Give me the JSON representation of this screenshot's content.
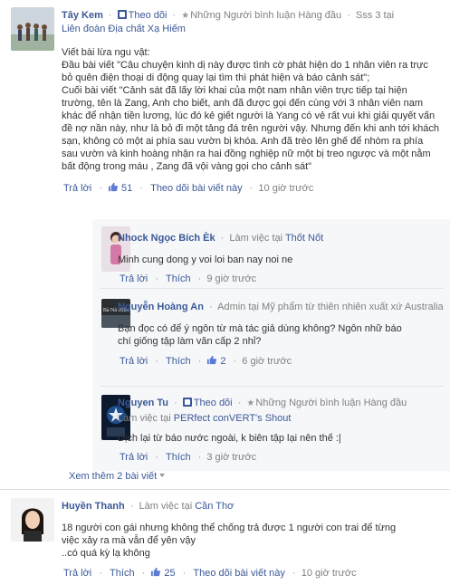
{
  "comments": [
    {
      "author": "Tây Kem",
      "follow_label": "Theo dõi",
      "badge": "Những Người bình luận Hàng đầu",
      "extra": "Sss 3 tại",
      "workplace": "Liên đoàn Địa chất Xạ Hiếm",
      "text": "Viết bài lừa ngu vật:\nĐầu bài viết \"Câu chuyện kinh dị này được tình cờ phát hiện do 1 nhân viên ra trực bỏ quên điện thoại di động quay lại tìm thì phát hiện và báo cảnh sát\";\nCuối bài viết \"Cảnh sát đã lấy lời khai của một nam nhân viên trực tiếp tại hiện trường, tên là Zang, Anh cho biết, anh đã được gọi đến cùng với 3 nhân viên nam khác để nhận tiền lương, lúc đó kẻ giết người là Yang có vẻ rất vui khi giải quyết vấn đề nợ nần này, như là bỏ đi một tảng đá trên người vậy. Nhưng đến khi anh tới khách sạn, không có một ai phía sau vườn bị khóa. Anh đã trèo lên ghế để nhòm ra phía sau vườn và kinh hoàng nhận ra hai đồng nghiệp nữ một bị treo ngược và một nằm bất động trong máu , Zang đã vội vàng gọi cho cảnh sát\"",
      "reply_label": "Trả lời",
      "like_count": "51",
      "follow_post_label": "Theo dõi bài viết này",
      "time": "10 giờ trước"
    },
    {
      "author": "Nhock Ngọc Bích Èk",
      "work_prefix": "Làm việc tại",
      "work_place": "Thốt Nốt",
      "text": "Minh cung dong y voi loi ban nay noi ne",
      "reply_label": "Trả lời",
      "like_label": "Thích",
      "time": "9 giờ trước"
    },
    {
      "author": "Nguyễn Hoàng An",
      "role": "Admin tại Mỹ phẩm từ thiên nhiên xuất xứ Australia",
      "text": "Bạn đọc có để ý ngôn từ mà tác giả dùng không? Ngôn nhữ báo chí giống tập làm văn cấp 2 nhỉ?",
      "reply_label": "Trả lời",
      "like_label": "Thích",
      "like_count": "2",
      "time": "6 giờ trước",
      "avatar_text": "Bà Nã Hills"
    },
    {
      "author": "Nguyen Tu",
      "follow_label": "Theo dõi",
      "badge": "Những Người bình luận Hàng đầu",
      "work_prefix": "Làm việc tại",
      "work_place": "PERfect conVERT's Shout",
      "text": "Dịch lại từ báo nước ngoài, k biên tập lại nên thế :|",
      "reply_label": "Trả lời",
      "like_label": "Thích",
      "time": "3 giờ trước"
    },
    {
      "author": "Huyền Thanh",
      "work_prefix": "Làm việc tại",
      "work_place": "Cần Thơ",
      "text": "18 người con gái nhưng không thể chống trả được 1 người con trai để từng việc xảy ra mà vẫn để yên vậy\n..có quá kỳ lạ không",
      "reply_label": "Trả lời",
      "like_label": "Thích",
      "like_count": "25",
      "follow_post_label": "Theo dõi bài viết này",
      "time": "10 giờ trước"
    }
  ],
  "more_replies_label": "Xem thêm 2 bài viết",
  "colors": {
    "link": "#3b5998",
    "meta": "#808080",
    "reply_bg": "#f6f7f9"
  }
}
